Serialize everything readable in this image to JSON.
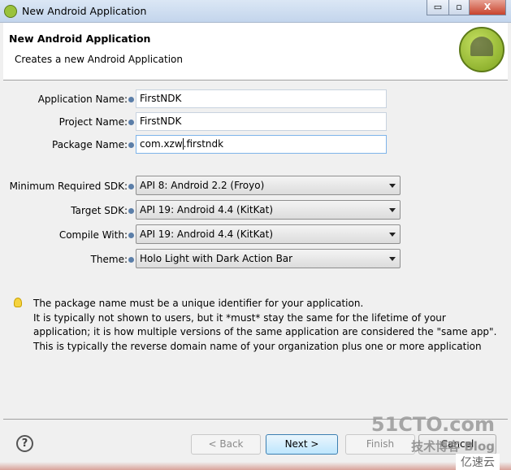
{
  "window": {
    "title": "New Android Application",
    "minimize": "▭",
    "maximize": "▫",
    "close": "X"
  },
  "header": {
    "title": "New Android Application",
    "subtitle": "Creates a new Android Application",
    "logo": "android-logo"
  },
  "fields": {
    "app_name": {
      "label": "Application Name:",
      "value": "FirstNDK"
    },
    "project_name": {
      "label": "Project Name:",
      "value": "FirstNDK"
    },
    "package_name": {
      "label": "Package Name:",
      "value_before_caret": "com.xzw",
      "value_after_caret": ".firstndk"
    }
  },
  "selects": {
    "min_sdk": {
      "label": "Minimum Required SDK:",
      "value": "API 8: Android 2.2 (Froyo)"
    },
    "target_sdk": {
      "label": "Target SDK:",
      "value": "API 19: Android 4.4 (KitKat)"
    },
    "compile_with": {
      "label": "Compile With:",
      "value": "API 19: Android 4.4 (KitKat)"
    },
    "theme": {
      "label": "Theme:",
      "value": "Holo Light with Dark Action Bar"
    }
  },
  "hint": {
    "lines": [
      "The package name must be a unique identifier for your application.",
      "It is typically not shown to users, but it *must* stay the same for the lifetime of your application; it is how multiple versions of the same application are considered the \"same app\".",
      "This is typically the reverse domain name of your organization plus one or more application"
    ]
  },
  "buttons": {
    "help": "?",
    "back": "< Back",
    "next": "Next >",
    "finish": "Finish",
    "cancel": "Cancel"
  },
  "watermark": {
    "line1": "51CTO.com",
    "line2": "技术博客 Blog",
    "line3": "亿速云"
  }
}
